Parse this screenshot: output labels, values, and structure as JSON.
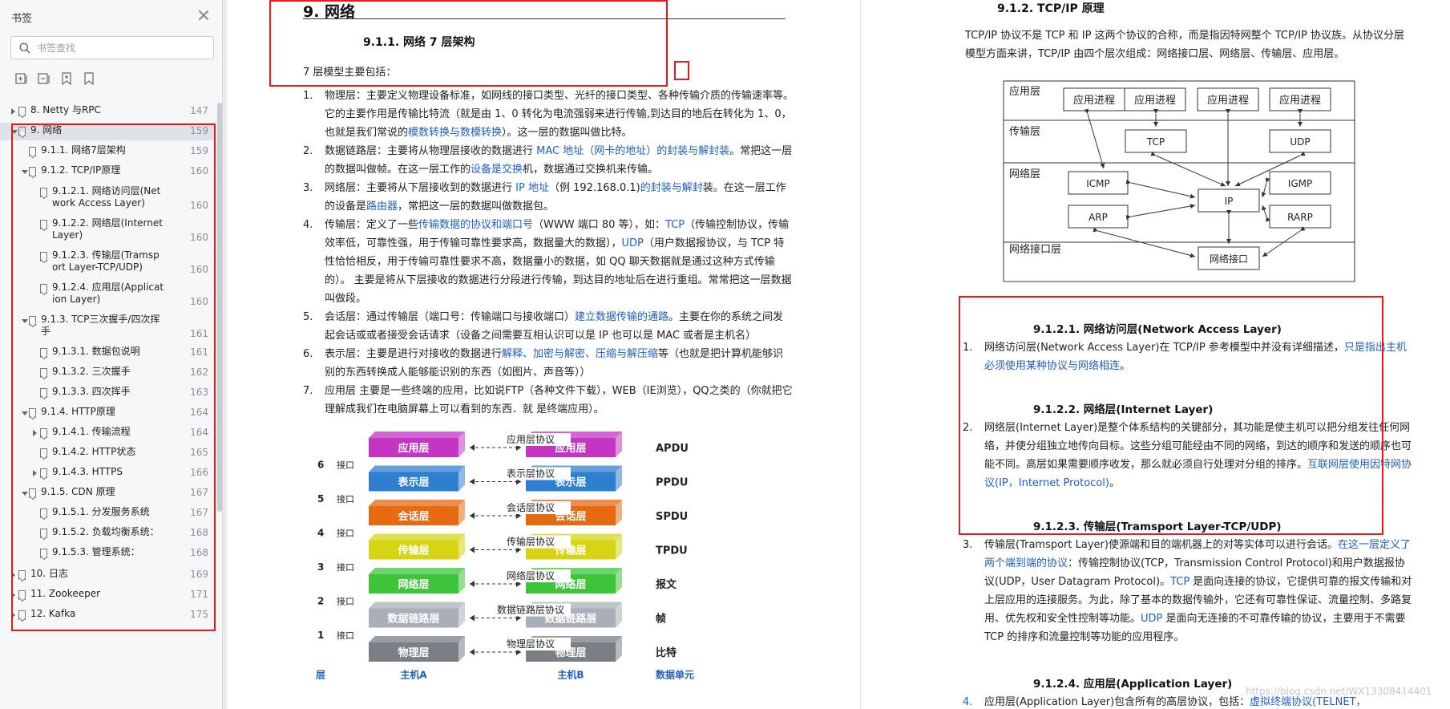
{
  "sidebar": {
    "title": "书签",
    "search_placeholder": "书签查找",
    "items": [
      {
        "label": "8. Netty 与RPC",
        "page": "147",
        "level": 0,
        "arrow": "closed"
      },
      {
        "label": "9. 网络",
        "page": "159",
        "level": 0,
        "arrow": "open",
        "selected": true
      },
      {
        "label": "9.1.1. 网络7层架构",
        "page": "159",
        "level": 1,
        "arrow": "none"
      },
      {
        "label": "9.1.2. TCP/IP原理",
        "page": "160",
        "level": 1,
        "arrow": "open"
      },
      {
        "label": "9.1.2.1. 网络访问层(Net\nwork Access Layer)",
        "page": "160",
        "level": 2,
        "arrow": "none"
      },
      {
        "label": "9.1.2.2. 网络层(Internet\nLayer)",
        "page": "160",
        "level": 2,
        "arrow": "none"
      },
      {
        "label": "9.1.2.3. 传输层(Tramsp\nort Layer-TCP/UDP)",
        "page": "160",
        "level": 2,
        "arrow": "none"
      },
      {
        "label": "9.1.2.4. 应用层(Applicat\nion Layer)",
        "page": "160",
        "level": 2,
        "arrow": "none"
      },
      {
        "label": "9.1.3. TCP三次握手/四次挥\n手",
        "page": "161",
        "level": 1,
        "arrow": "open"
      },
      {
        "label": "9.1.3.1. 数据包说明",
        "page": "161",
        "level": 2,
        "arrow": "none"
      },
      {
        "label": "9.1.3.2. 三次握手",
        "page": "162",
        "level": 2,
        "arrow": "none"
      },
      {
        "label": "9.1.3.3. 四次挥手",
        "page": "163",
        "level": 2,
        "arrow": "none"
      },
      {
        "label": "9.1.4. HTTP原理",
        "page": "164",
        "level": 1,
        "arrow": "open"
      },
      {
        "label": "9.1.4.1. 传输流程",
        "page": "164",
        "level": 2,
        "arrow": "closed"
      },
      {
        "label": "9.1.4.2. HTTP状态",
        "page": "165",
        "level": 2,
        "arrow": "none"
      },
      {
        "label": "9.1.4.3. HTTPS",
        "page": "166",
        "level": 2,
        "arrow": "closed"
      },
      {
        "label": "9.1.5. CDN 原理",
        "page": "167",
        "level": 1,
        "arrow": "open"
      },
      {
        "label": "9.1.5.1. 分发服务系统",
        "page": "167",
        "level": 2,
        "arrow": "none"
      },
      {
        "label": "9.1.5.2. 负载均衡系统：",
        "page": "168",
        "level": 2,
        "arrow": "none"
      },
      {
        "label": "9.1.5.3. 管理系统：",
        "page": "168",
        "level": 2,
        "arrow": "none"
      },
      {
        "label": "10. 日志",
        "page": "169",
        "level": 0,
        "arrow": "closed"
      },
      {
        "label": "11. Zookeeper",
        "page": "171",
        "level": 0,
        "arrow": "closed"
      },
      {
        "label": "12. Kafka",
        "page": "175",
        "level": 0,
        "arrow": "closed"
      }
    ]
  },
  "left_page": {
    "chapter_title": "9. 网络",
    "section_title": "9.1.1.  网络 7 层架构",
    "intro": "7 层模型主要包括：",
    "items": [
      {
        "num": "1.",
        "segments": [
          {
            "t": "物理层：主要定义物理设备标准，如网线的接口类型、光纤的接口类型、各种传输介质的传输速率等。它的主要作用是传输比特流（就是由 1、0 转化为电流强弱来进行传输,到达目的地后在转化为 1、0，也就是我们常说的"
          },
          {
            "t": "模数转换与数模转换",
            "link": true
          },
          {
            "t": "）。这一层的数据叫做比特。"
          }
        ]
      },
      {
        "num": "2.",
        "segments": [
          {
            "t": "数据链路层：主要将从物理层接收的数据进行 "
          },
          {
            "t": "MAC 地址（网卡的地址）的封装与解封装",
            "link": true
          },
          {
            "t": "。常把这一层的数据叫做帧。在这一层工作的"
          },
          {
            "t": "设备是交换",
            "link": true
          },
          {
            "t": "机，数据通过交换机来传输。"
          }
        ]
      },
      {
        "num": "3.",
        "segments": [
          {
            "t": "网络层：主要将从下层接收到的数据进行 "
          },
          {
            "t": "IP 地址",
            "link": true
          },
          {
            "t": "（例 192.168.0.1)"
          },
          {
            "t": "的封装与解封",
            "link": true
          },
          {
            "t": "装。在这一层工作的设备是"
          },
          {
            "t": "路由器",
            "link": true
          },
          {
            "t": "，常把这一层的数据叫做数据包。"
          }
        ]
      },
      {
        "num": "4.",
        "segments": [
          {
            "t": "传输层：定义了一些"
          },
          {
            "t": "传输数据的协议和端口号",
            "link": true
          },
          {
            "t": "（WWW 端口 80 等），如："
          },
          {
            "t": "TCP",
            "link": true
          },
          {
            "t": "（传输控制协议，传输效率低，可靠性强，用于传输可靠性要求高，数据量大的数据），"
          },
          {
            "t": "UDP",
            "link": true
          },
          {
            "t": "（用户数据报协议，与 TCP 特性恰恰相反，用于传输可靠性要求不高，数据量小的数据，如 QQ 聊天数据就是通过这种方式传输的）。 主要是将从下层接收的数据进行分段进行传输，到达目的地址后在进行重组。常常把这一层数据叫做段。"
          }
        ]
      },
      {
        "num": "5.",
        "segments": [
          {
            "t": "会话层：通过传输层（端口号：传输端口与接收端口）"
          },
          {
            "t": "建立数据传输的通路",
            "link": true
          },
          {
            "t": "。主要在你的系统之间发起会话或或者接受会话请求（设备之间需要互相认识可以是 IP 也可以是 MAC 或者是主机名）"
          }
        ]
      },
      {
        "num": "6.",
        "segments": [
          {
            "t": "表示层：主要是进行对接收的数据进行"
          },
          {
            "t": "解释、加密与解密、压缩与解压缩",
            "link": true
          },
          {
            "t": "等（也就是把计算机能够识别的东西转换成人能够能识别的东西（如图片、声音等））"
          }
        ]
      },
      {
        "num": "7.",
        "segments": [
          {
            "t": "应用层 主要是一些终端的应用，比如说FTP（各种文件下载），WEB（IE浏览），QQ之类的（你就把它理解成我们在电脑屏幕上可以看到的东西．就 是终端应用）。"
          }
        ]
      }
    ],
    "osi_diagram": {
      "layers": [
        {
          "name": "应用层",
          "proto": "应用层协议",
          "num": "6",
          "unit": "APDU",
          "color": "#c236c2"
        },
        {
          "name": "表示层",
          "proto": "表示层协议",
          "num": "5",
          "unit": "PPDU",
          "color": "#2f7fd0"
        },
        {
          "name": "会话层",
          "proto": "会话层协议",
          "num": "4",
          "unit": "SPDU",
          "color": "#e56a12"
        },
        {
          "name": "传输层",
          "proto": "传输层协议",
          "num": "3",
          "unit": "TPDU",
          "color": "#d6d414"
        },
        {
          "name": "网络层",
          "proto": "网络层协议",
          "num": "2",
          "unit": "报文",
          "color": "#3ec43a"
        },
        {
          "name": "数据链路层",
          "proto": "数据链路层协议",
          "num": "1",
          "unit": "帧",
          "color": "#a9afb8"
        },
        {
          "name": "物理层",
          "proto": "物理层协议",
          "num": "",
          "unit": "比特",
          "color": "#7a7f86"
        }
      ],
      "interface_label": "接口",
      "footer": {
        "layer": "层",
        "host_a": "主机A",
        "host_b": "主机B",
        "unit": "数据单元"
      }
    }
  },
  "right_page": {
    "top_title": "9.1.2.  TCP/IP 原理",
    "intro": "TCP/IP 协议不是 TCP 和 IP 这两个协议的合称，而是指因特网整个 TCP/IP 协议族。从协议分层模型方面来讲，TCP/IP 由四个层次组成：网络接口层、网络层、传输层、应用层。",
    "tcpip_diagram": {
      "layer_labels": [
        "应用层",
        "传输层",
        "网络层",
        "网络接口层"
      ],
      "app_procs": [
        "应用进程",
        "应用进程",
        "应用进程",
        "应用进程"
      ],
      "tcp": "TCP",
      "udp": "UDP",
      "icmp": "ICMP",
      "igmp": "IGMP",
      "ip": "IP",
      "arp": "ARP",
      "rarp": "RARP",
      "iface": "网络接口"
    },
    "sections": [
      {
        "title": "9.1.2.1.      网络访问层(Network Access Layer)",
        "num": "1.",
        "segments": [
          {
            "t": "网络访问层(Network Access Layer)在 TCP/IP 参考模型中并没有详细描述，"
          },
          {
            "t": "只是指出主机必须使用某种协议与网络相连",
            "link": true
          },
          {
            "t": "。"
          }
        ]
      },
      {
        "title": "9.1.2.2.      网络层(Internet Layer)",
        "num": "2.",
        "segments": [
          {
            "t": "网络层(Internet Layer)是整个体系结构的关键部分，其功能是使主机可以把分组发往任何网络，并使分组独立地传向目标。这些分组可能经由不同的网络，到达的顺序和发送的顺序也可能不同。高层如果需要顺序收发，那么就必须自行处理对分组的排序。"
          },
          {
            "t": "互联网层使用因特网协议(IP，Internet Protocol)",
            "link": true
          },
          {
            "t": "。"
          }
        ]
      },
      {
        "title": "9.1.2.3.      传输层(Tramsport Layer-TCP/UDP)",
        "num": "3.",
        "segments": [
          {
            "t": "传输层(Tramsport Layer)使源端和目的端机器上的对等实体可以进行会话。"
          },
          {
            "t": "在这一层定义了两个端到端的协议",
            "link": true
          },
          {
            "t": "：传输控制协议(TCP，Transmission Control Protocol)和用户数据报协议(UDP，User Datagram Protocol)。"
          },
          {
            "t": "TCP",
            "link": true
          },
          {
            "t": " 是面向连接的协议，它提供可靠的报文传输和对上层应用的连接服务。为此，除了基本的数据传输外，它还有可靠性保证、流量控制、多路复用、优先权和安全性控制等功能。"
          },
          {
            "t": "UDP",
            "link": true
          },
          {
            "t": " 是面向无连接的不可靠传输的协议，主要用于不需要 TCP 的排序和流量控制等功能的应用程序。"
          }
        ]
      },
      {
        "title": "9.1.2.4.      应用层(Application Layer)",
        "num": "4.",
        "segments": [
          {
            "t": "应用层(Application Layer)包含所有的高层协议，包括："
          },
          {
            "t": "虚拟终端协议(TELNET，",
            "link": true
          }
        ]
      }
    ],
    "watermark": "https://blog.csdn.net/WX13308414401"
  }
}
